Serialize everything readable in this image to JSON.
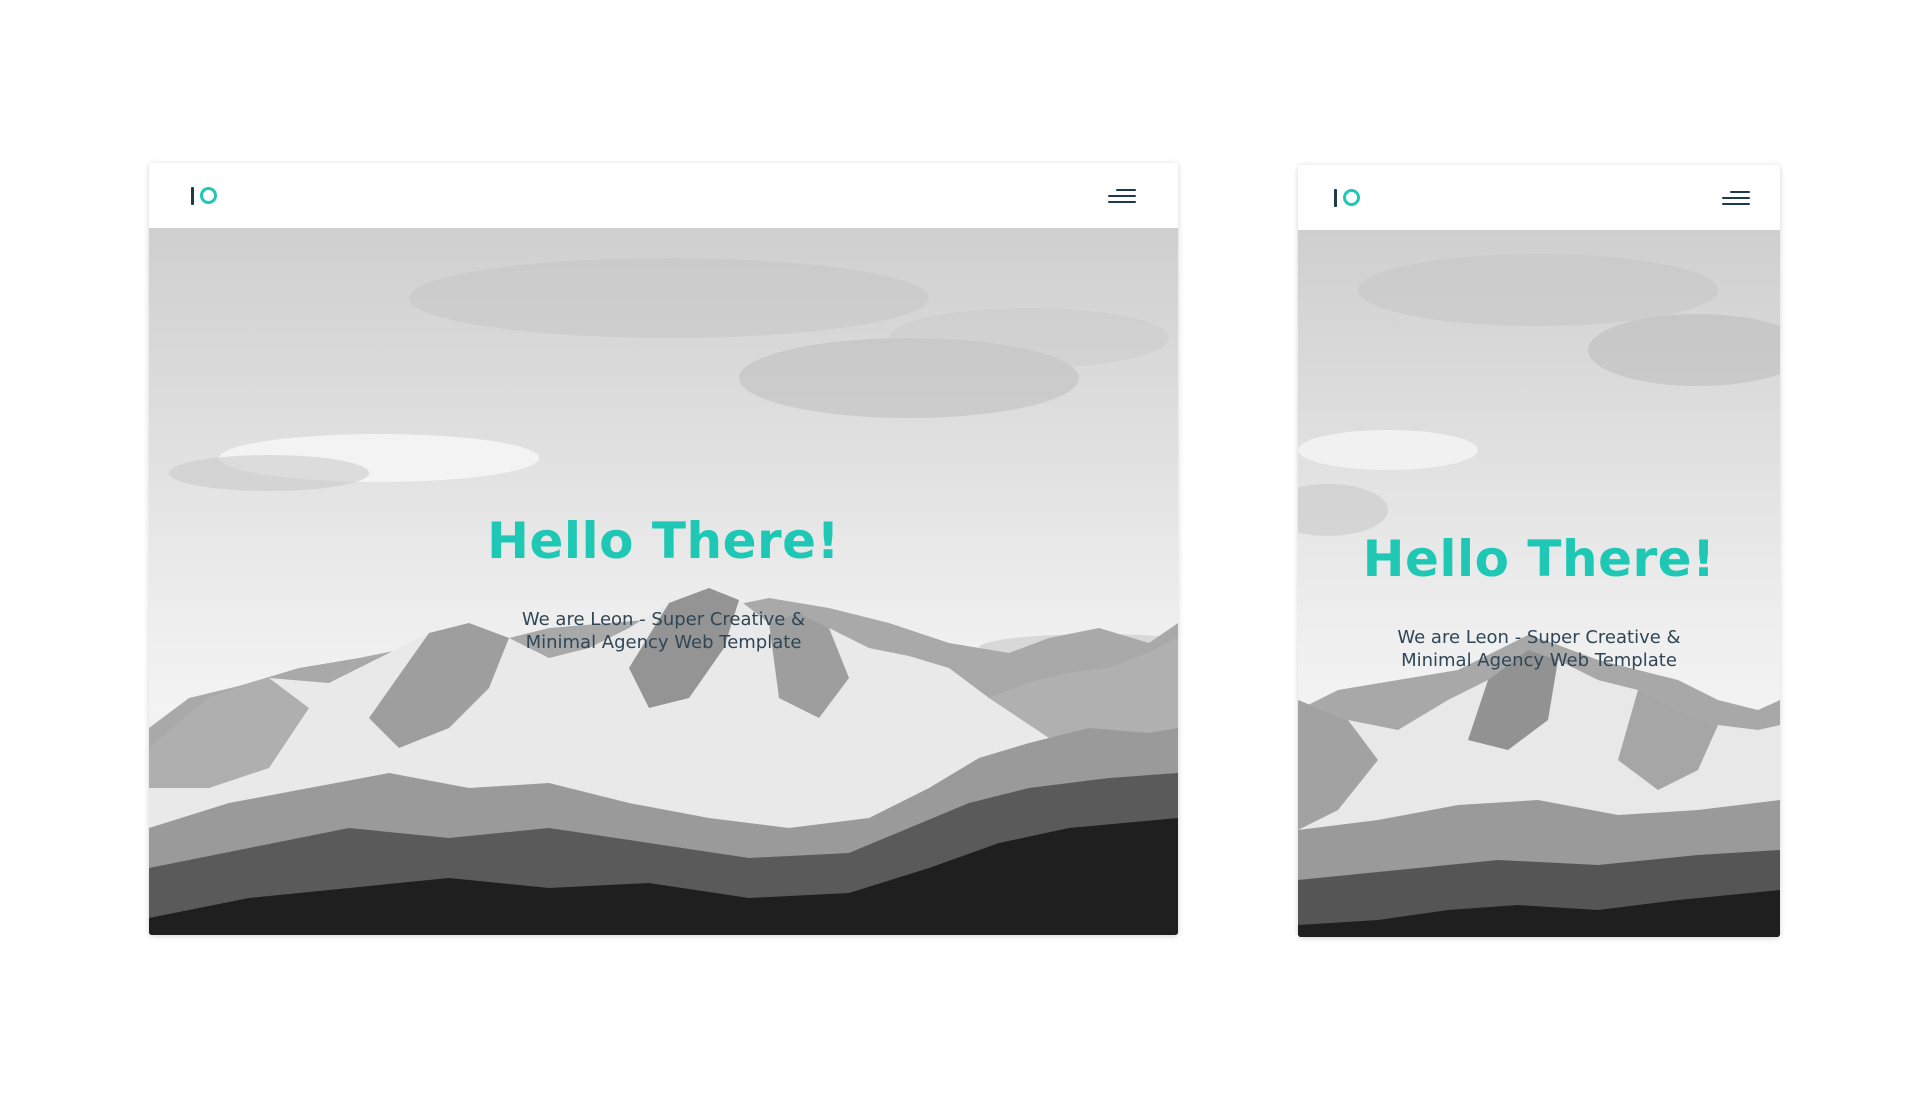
{
  "colors": {
    "accent": "#1fc8b4",
    "navy": "#1e3a4c",
    "subtitle": "#2f4656",
    "background": "#ffffff"
  },
  "desktop_preview": {
    "logo": {
      "icon": "leon-logo-icon"
    },
    "menu": {
      "icon": "hamburger-menu-icon"
    },
    "hero": {
      "title": "Hello There!",
      "subtitle_line1": "We are Leon - Super Creative &",
      "subtitle_line2": "Minimal Agency Web Template",
      "background": "snowy-mountains-black-and-white-photo"
    }
  },
  "mobile_preview": {
    "logo": {
      "icon": "leon-logo-icon"
    },
    "menu": {
      "icon": "hamburger-menu-icon"
    },
    "hero": {
      "title": "Hello There!",
      "subtitle_line1": "We are Leon - Super Creative &",
      "subtitle_line2": "Minimal Agency Web Template",
      "background": "snowy-mountains-black-and-white-photo"
    }
  }
}
